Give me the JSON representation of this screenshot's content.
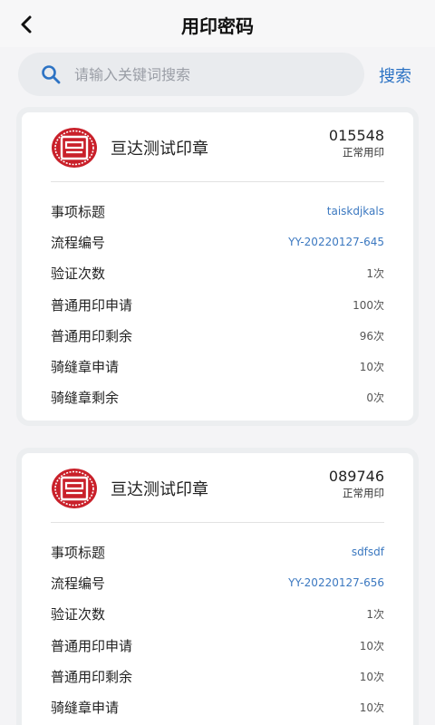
{
  "header": {
    "title": "用印密码",
    "back_icon": "chevron-left-icon"
  },
  "search": {
    "placeholder": "请输入关键词搜索",
    "value": "",
    "button_label": "搜索",
    "icon": "search-icon"
  },
  "colors": {
    "accent": "#2d73c4",
    "seal_red": "#c9202a",
    "background": "#f4f4f6"
  },
  "cards": [
    {
      "seal_name": "亘达测试印章",
      "seal_number": "015548",
      "seal_type": "正常用印",
      "rows": [
        {
          "label": "事项标题",
          "value": "taiskdjkals"
        },
        {
          "label": "流程编号",
          "value": "YY-20220127-645"
        },
        {
          "label": "验证次数",
          "value": "1次"
        },
        {
          "label": "普通用印申请",
          "value": "100次"
        },
        {
          "label": "普通用印剩余",
          "value": "96次"
        },
        {
          "label": "骑缝章申请",
          "value": "10次"
        },
        {
          "label": "骑缝章剩余",
          "value": "0次"
        }
      ]
    },
    {
      "seal_name": "亘达测试印章",
      "seal_number": "089746",
      "seal_type": "正常用印",
      "rows": [
        {
          "label": "事项标题",
          "value": "sdfsdf"
        },
        {
          "label": "流程编号",
          "value": "YY-20220127-656"
        },
        {
          "label": "验证次数",
          "value": "1次"
        },
        {
          "label": "普通用印申请",
          "value": "10次"
        },
        {
          "label": "普通用印剩余",
          "value": "10次"
        },
        {
          "label": "骑缝章申请",
          "value": "10次"
        }
      ]
    }
  ]
}
